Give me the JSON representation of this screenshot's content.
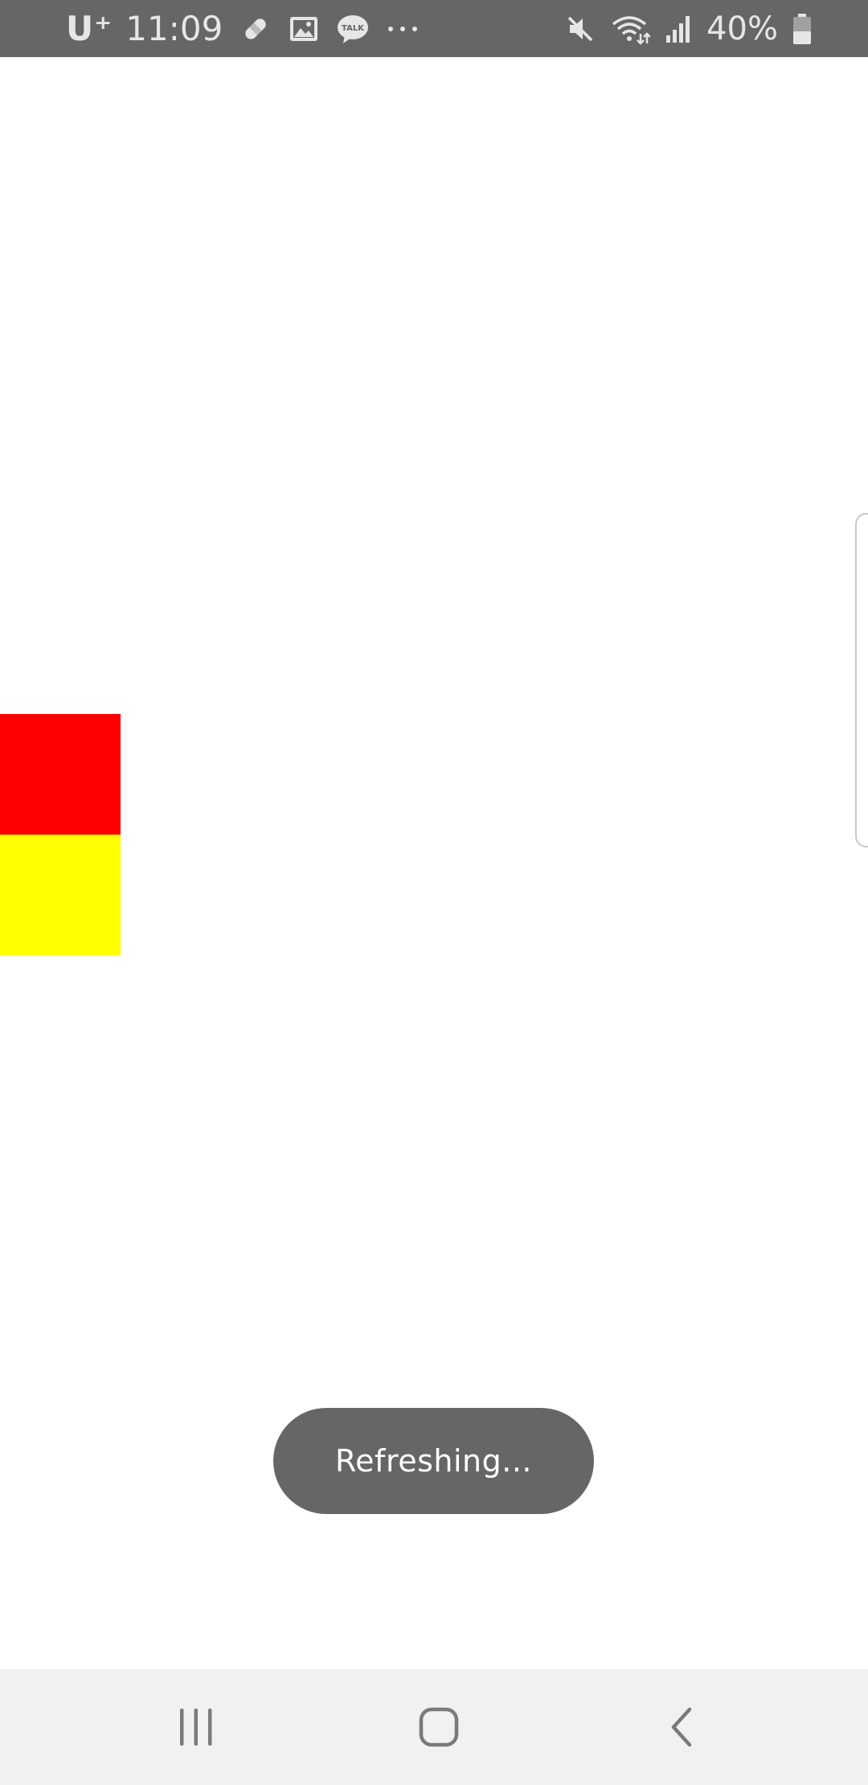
{
  "status_bar": {
    "carrier": "U⁺",
    "time": "11:09",
    "battery": "40%",
    "notification_icons": [
      "bandage-icon",
      "gallery-icon",
      "talk-icon",
      "more-dots-icon"
    ],
    "system_icons": [
      "mute-icon",
      "wifi-icon",
      "signal-icon",
      "battery-icon"
    ],
    "talk_badge": "TALK"
  },
  "content": {
    "blocks": [
      {
        "name": "red-block",
        "color": "#ff0000"
      },
      {
        "name": "yellow-block",
        "color": "#ffff00"
      }
    ]
  },
  "toast": {
    "message": "Refreshing..."
  },
  "nav_bar": {
    "buttons": [
      "recents-icon",
      "home-icon",
      "back-icon"
    ]
  },
  "colors": {
    "status_bar_bg": "#666666",
    "toast_bg": "#666666",
    "nav_bar_bg": "#f1f1f1"
  }
}
